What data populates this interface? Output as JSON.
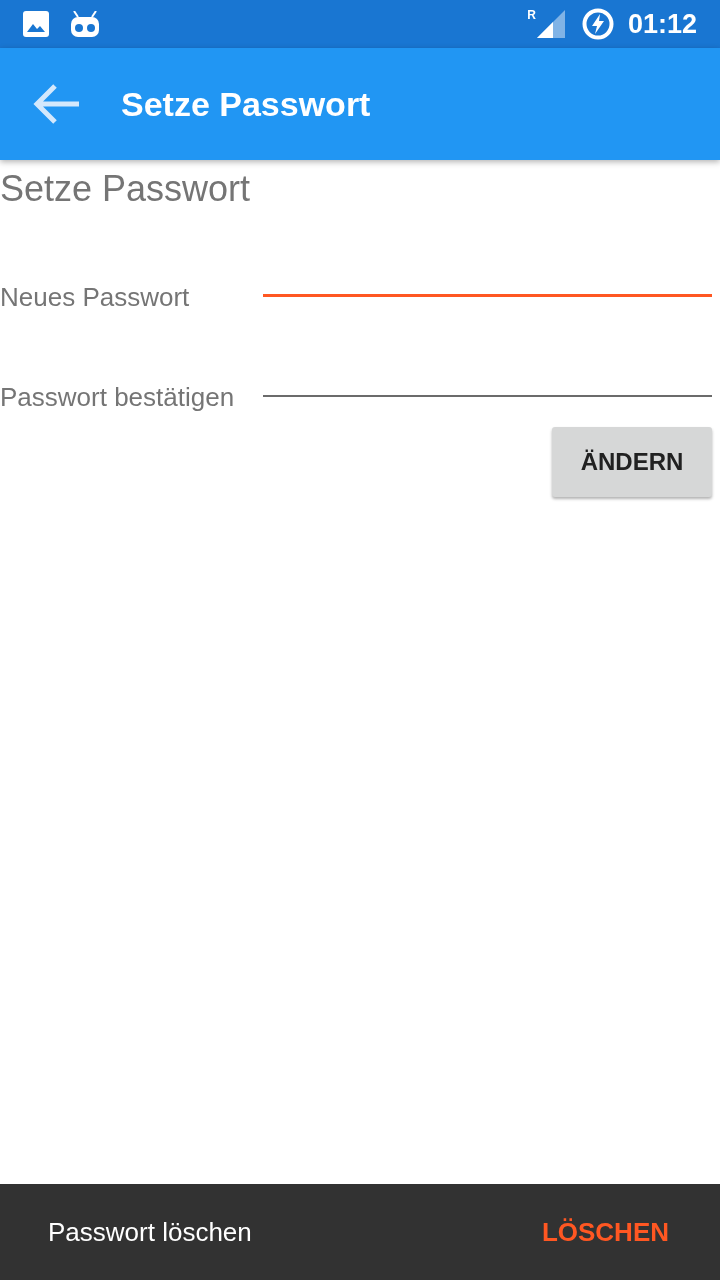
{
  "status_bar": {
    "network_label": "R",
    "time": "01:12"
  },
  "app_bar": {
    "title": "Setze Passwort"
  },
  "heading": "Setze Passwort",
  "fields": [
    {
      "label": "Neues Passwort",
      "focused": true
    },
    {
      "label": "Passwort bestätigen",
      "focused": false
    }
  ],
  "button": "ÄNDERN",
  "snackbar": {
    "message": "Passwort löschen",
    "action": "LÖSCHEN"
  }
}
